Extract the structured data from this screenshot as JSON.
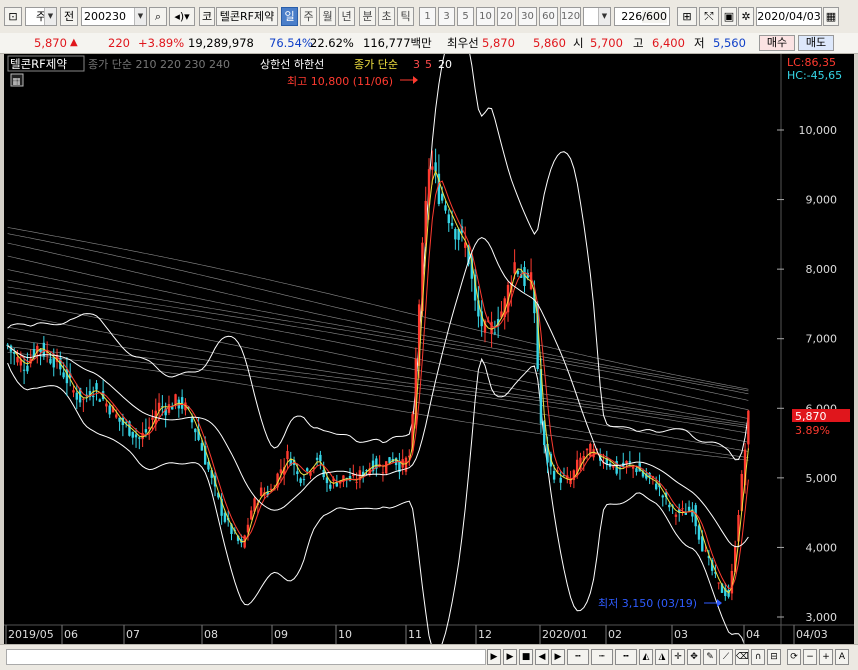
{
  "toolbar": {
    "market": "주",
    "prev_label": "전",
    "code": "200230",
    "kospi_label": "코",
    "stock_name": "텔콘RF제약",
    "periods": [
      "일",
      "주",
      "월",
      "년",
      "분",
      "초",
      "틱"
    ],
    "intervals": [
      "1",
      "3",
      "5",
      "10",
      "20",
      "30",
      "60",
      "120"
    ],
    "count": "226",
    "count_total": "/600",
    "date": "2020/04/03"
  },
  "quote": {
    "price": "5,870",
    "arrow": "▲",
    "change": "220",
    "change_pct": "+3.89%",
    "volume": "19,289,978",
    "ratio1": "76.54%",
    "ratio2": "22.62%",
    "amount": "116,777백만",
    "best_ask_label": "최우선",
    "best_ask": "5,870",
    "best_bid": "5,860",
    "open_label": "시",
    "open": "5,700",
    "high_label": "고",
    "high": "6,400",
    "low_label": "저",
    "low": "5,560",
    "buy_label": "매수",
    "sell_label": "매도"
  },
  "chart": {
    "legend_name": "텔콘RF제약",
    "legend_ma_gray": "종가 단순 210 220 230 240",
    "legend_limit": "상한선 하한선",
    "legend_ma_yellow": "종가 단순",
    "legend_ma_periods": [
      "3",
      "5",
      "20"
    ],
    "lc": "LC:86,35",
    "hc": "HC:-45,65",
    "high_note": "최고 10,800 (11/06)",
    "low_note": "최저 3,150 (03/19)",
    "price_tag": "5,870",
    "pct_tag": "3.89%",
    "colors": {
      "up": "#ff3b30",
      "down": "#36d6e7",
      "ma_gray": "#8a8a8a",
      "band": "#ffffff",
      "yellow": "#f0e040"
    }
  },
  "chart_data": {
    "type": "candlestick",
    "yticks": [
      "10,000",
      "9,000",
      "8,000",
      "7,000",
      "6,000",
      "5,000",
      "4,000",
      "3,000"
    ],
    "xticks": [
      "2019/05",
      "06",
      "07",
      "08",
      "09",
      "10",
      "11",
      "12",
      "2020/01",
      "02",
      "03",
      "04",
      "04/03"
    ],
    "ylim": [
      3000,
      10000
    ],
    "close_path": [
      6900,
      6700,
      6600,
      6900,
      6800,
      6700,
      6500,
      6250,
      6100,
      6300,
      6150,
      6000,
      5800,
      5700,
      5550,
      5700,
      6050,
      6000,
      6100,
      6000,
      5700,
      5300,
      4850,
      4450,
      4200,
      4000,
      4550,
      4800,
      4800,
      5100,
      5350,
      5000,
      5100,
      5300,
      4900,
      4950,
      5000,
      4950,
      5100,
      5200,
      5150,
      5300,
      5150,
      5350,
      7800,
      9600,
      9100,
      8800,
      8500,
      8300,
      7350,
      7100,
      7200,
      7500,
      8100,
      7850,
      7800,
      5500,
      5100,
      5000,
      4950,
      5250,
      5400,
      5300,
      5250,
      5100,
      5200,
      5150,
      5000,
      4950,
      4700,
      4500,
      4500,
      4550,
      4050,
      3700,
      3400,
      3300,
      4600,
      5870
    ],
    "series": [
      {
        "name": "3",
        "values": []
      },
      {
        "name": "5",
        "values": []
      },
      {
        "name": "20",
        "values": []
      }
    ]
  },
  "bottom": {
    "zoom_minus": "−",
    "zoom_plus": "+",
    "zoom_a": "A"
  }
}
